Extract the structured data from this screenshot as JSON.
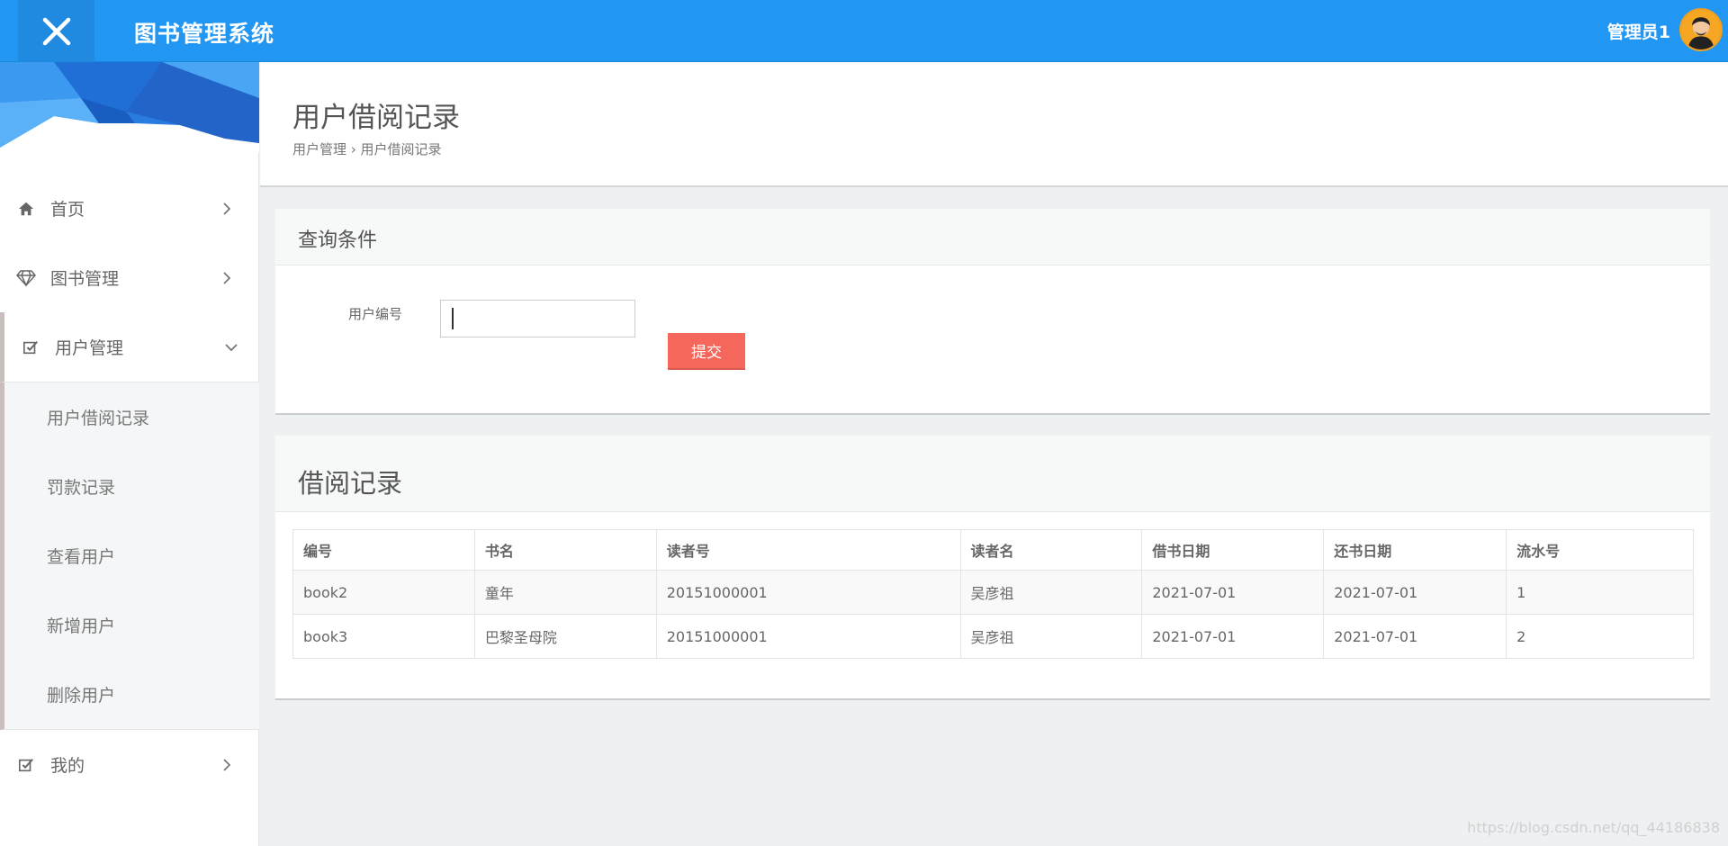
{
  "header": {
    "app_title": "图书管理系统",
    "user_name": "管理员1"
  },
  "sidebar": {
    "items": [
      {
        "label": "首页",
        "icon": "home-icon"
      },
      {
        "label": "图书管理",
        "icon": "diamond-icon"
      },
      {
        "label": "用户管理",
        "icon": "checkbox-icon",
        "expanded": true,
        "children": [
          "用户借阅记录",
          "罚款记录",
          "查看用户",
          "新增用户",
          "删除用户"
        ]
      },
      {
        "label": "我的",
        "icon": "checkbox-icon"
      }
    ]
  },
  "page": {
    "title": "用户借阅记录",
    "breadcrumb": "用户管理 › 用户借阅记录"
  },
  "query": {
    "title": "查询条件",
    "field_label": "用户编号",
    "field_value": "",
    "submit_label": "提交"
  },
  "records": {
    "title": "借阅记录",
    "columns": [
      "编号",
      "书名",
      "读者号",
      "读者名",
      "借书日期",
      "还书日期",
      "流水号"
    ],
    "rows": [
      [
        "book2",
        "童年",
        "20151000001",
        "吴彦祖",
        "2021-07-01",
        "2021-07-01",
        "1"
      ],
      [
        "book3",
        "巴黎圣母院",
        "20151000001",
        "吴彦祖",
        "2021-07-01",
        "2021-07-01",
        "2"
      ]
    ]
  },
  "watermark": "https://blog.csdn.net/qq_44186838",
  "colors": {
    "header": "#2196f3",
    "submit": "#f5675a"
  }
}
